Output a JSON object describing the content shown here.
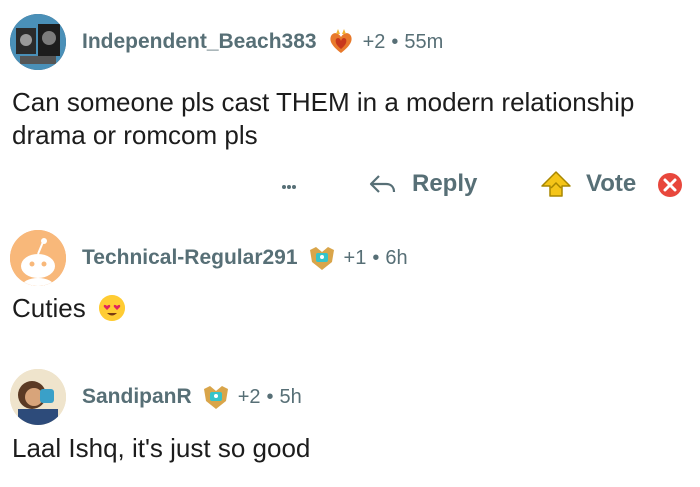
{
  "comments": [
    {
      "username": "Independent_Beach383",
      "karma": "+2",
      "time": "55m",
      "text": "Can someone pls cast THEM in a modern relationship drama or romcom pls",
      "flair_icon": "fire-heart-icon",
      "avatar_icon": "robot-avatar"
    },
    {
      "username": "Technical-Regular291",
      "karma": "+1",
      "time": "6h",
      "text": "Cuties",
      "emoji": "heart-eyes-emoji",
      "flair_icon": "shield-badge-icon",
      "avatar_icon": "snoo-avatar"
    },
    {
      "username": "SandipanR",
      "karma": "+2",
      "time": "5h",
      "text": "Laal Ishq, it's just so good",
      "flair_icon": "shield-badge-icon",
      "avatar_icon": "cartoon-avatar"
    }
  ],
  "actions": {
    "reply_label": "Reply",
    "vote_label": "Vote"
  },
  "colors": {
    "meta": "#576f76",
    "text": "#1c1c1c",
    "vote_up": "#f5c518",
    "downvote": "#e8473c"
  }
}
